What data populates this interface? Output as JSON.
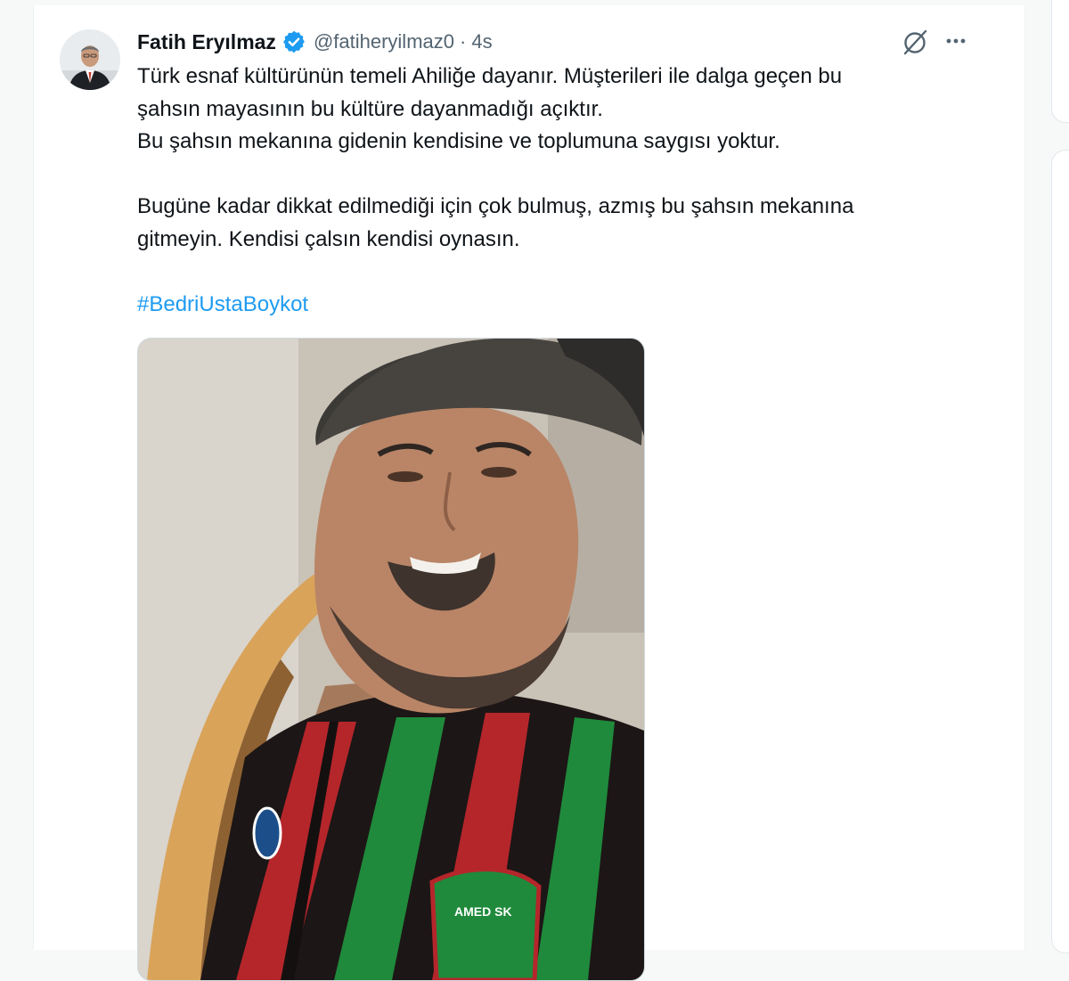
{
  "tweet": {
    "author": {
      "display_name": "Fatih Eryılmaz",
      "handle": "@fatiheryilmaz0",
      "verified": true,
      "avatar_icon": "profile-photo"
    },
    "separator": "·",
    "timestamp": "4s",
    "actions": {
      "grok_icon": "grok-icon",
      "more_icon": "ellipsis-icon"
    },
    "text": {
      "line1": "Türk esnaf kültürünün temeli Ahiliğe dayanır. Müşterileri ile dalga geçen bu",
      "line2": "şahsın mayasının bu kültüre dayanmadığı açıktır.",
      "line3": "Bu şahsın mekanına gidenin kendisine ve toplumuna saygısı yoktur.",
      "line4": "Bugüne kadar dikkat edilmediği için çok bulmuş, azmış bu şahsın mekanına",
      "line5": "gitmeyin. Kendisi çalsın kendisi oynasın.",
      "hashtag": "#BedriUstaBoykot"
    },
    "media": {
      "kind": "photo",
      "subject": "smiling man in cap and striped jersey",
      "jersey_badge_text": "AMED SK"
    }
  },
  "colors": {
    "link": "#1d9bf0",
    "verified": "#1d9bf0",
    "secondary_text": "#536471",
    "primary_text": "#0f1419"
  }
}
